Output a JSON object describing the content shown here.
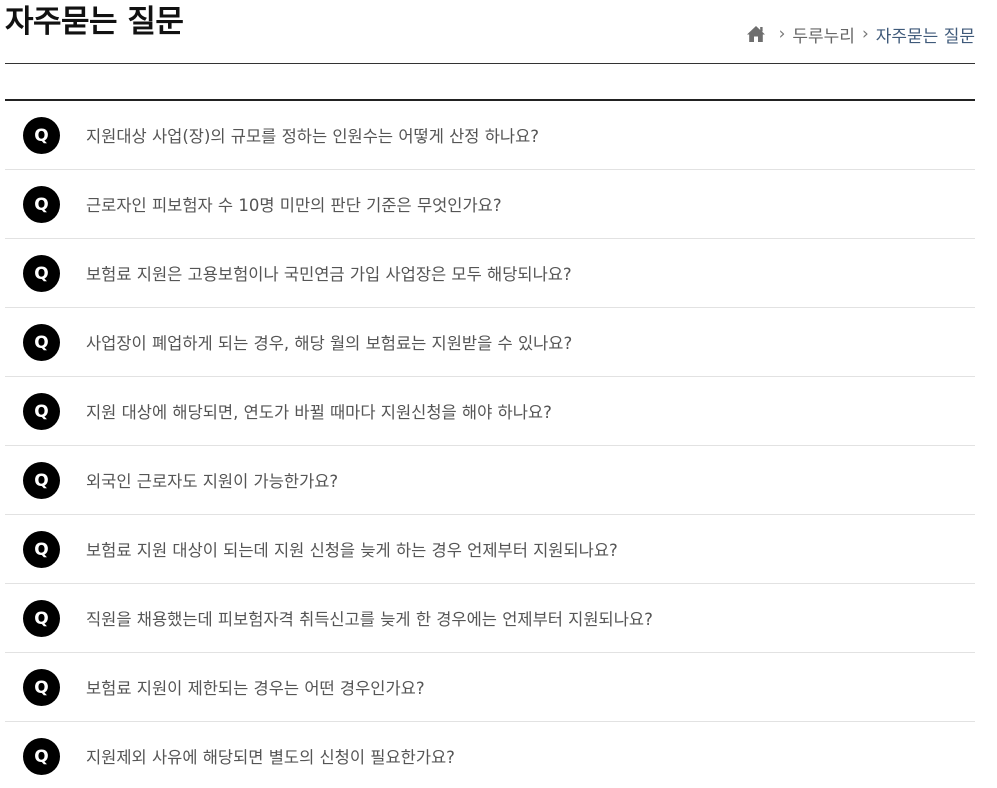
{
  "page": {
    "title": "자주묻는 질문"
  },
  "breadcrumb": {
    "home_icon": "home-icon",
    "separator": "›",
    "items": [
      "두루누리",
      "자주묻는 질문"
    ]
  },
  "faq": {
    "badge_label": "Q",
    "items": [
      "지원대상 사업(장)의 규모를 정하는 인원수는 어떻게 산정 하나요?",
      "근로자인 피보험자 수 10명 미만의 판단 기준은 무엇인가요?",
      "보험료 지원은 고용보험이나 국민연금 가입 사업장은 모두 해당되나요?",
      "사업장이 폐업하게 되는 경우, 해당 월의 보험료는 지원받을 수 있나요?",
      "지원 대상에 해당되면, 연도가 바뀔 때마다 지원신청을 해야 하나요?",
      "외국인 근로자도 지원이 가능한가요?",
      "보험료 지원 대상이 되는데 지원 신청을 늦게 하는 경우 언제부터 지원되나요?",
      "직원을 채용했는데 피보험자격 취득신고를 늦게 한 경우에는 언제부터 지원되나요?",
      "보험료 지원이 제한되는 경우는 어떤 경우인가요?",
      "지원제외 사유에 해당되면 별도의 신청이 필요한가요?"
    ]
  },
  "colors": {
    "badge_bg": "#000000",
    "question_text": "#555555",
    "breadcrumb_current": "#3f5a7a",
    "divider": "#e2e2e2"
  }
}
